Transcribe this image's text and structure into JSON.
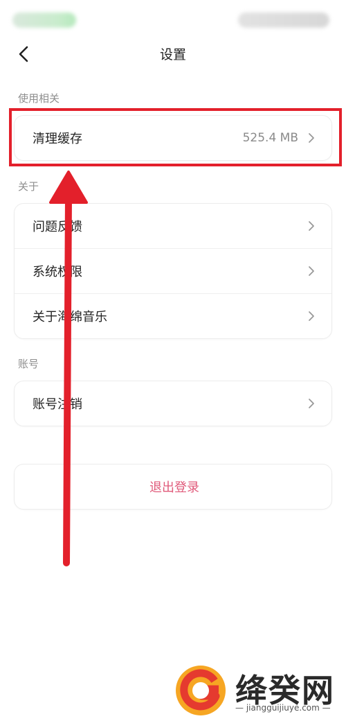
{
  "header": {
    "title": "设置"
  },
  "sections": {
    "usage": {
      "label": "使用相关",
      "items": [
        {
          "label": "清理缓存",
          "value": "525.4 MB"
        }
      ]
    },
    "about": {
      "label": "关于",
      "items": [
        {
          "label": "问题反馈"
        },
        {
          "label": "系统权限"
        },
        {
          "label": "关于海绵音乐"
        }
      ]
    },
    "account": {
      "label": "账号",
      "items": [
        {
          "label": "账号注销"
        }
      ]
    }
  },
  "logout": {
    "label": "退出登录"
  },
  "annotation": {
    "highlight_color": "#e3202b",
    "arrow_color": "#e3202b"
  },
  "watermark": {
    "name": "绛癸网",
    "domain": "jiangguijiuye.com"
  },
  "colors": {
    "logout_text": "#e05a7a",
    "logo_orange": "#f6a623",
    "logo_red": "#e53a2f"
  }
}
